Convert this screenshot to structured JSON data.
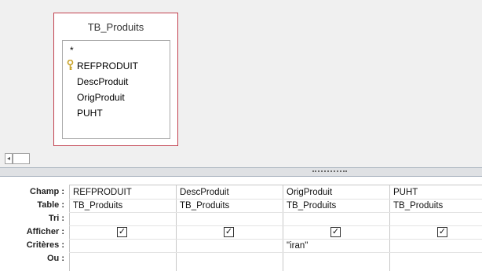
{
  "table": {
    "title": "TB_Produits",
    "fields": [
      {
        "label": "*",
        "is_key": false
      },
      {
        "label": "REFPRODUIT",
        "is_key": true
      },
      {
        "label": "DescProduit",
        "is_key": false
      },
      {
        "label": "OrigProduit",
        "is_key": false
      },
      {
        "label": "PUHT",
        "is_key": false
      }
    ]
  },
  "grid": {
    "row_labels": {
      "champ": "Champ :",
      "table": "Table :",
      "tri": "Tri :",
      "afficher": "Afficher :",
      "criteres": "Critères :",
      "ou": "Ou :"
    },
    "columns": [
      {
        "champ": "REFPRODUIT",
        "table": "TB_Produits",
        "tri": "",
        "afficher": true,
        "criteres": "",
        "ou": ""
      },
      {
        "champ": "DescProduit",
        "table": "TB_Produits",
        "tri": "",
        "afficher": true,
        "criteres": "",
        "ou": ""
      },
      {
        "champ": "OrigProduit",
        "table": "TB_Produits",
        "tri": "",
        "afficher": true,
        "criteres": "\"iran\"",
        "ou": ""
      },
      {
        "champ": "PUHT",
        "table": "TB_Produits",
        "tri": "",
        "afficher": true,
        "criteres": "",
        "ou": ""
      }
    ]
  },
  "colors": {
    "table_border": "#c2414f",
    "key_icon": "#c9a227",
    "pane_background": "#f0f0f0"
  },
  "icons": {
    "key": "key-icon",
    "check": "check-icon",
    "scroll_left": "scroll-left-icon"
  }
}
